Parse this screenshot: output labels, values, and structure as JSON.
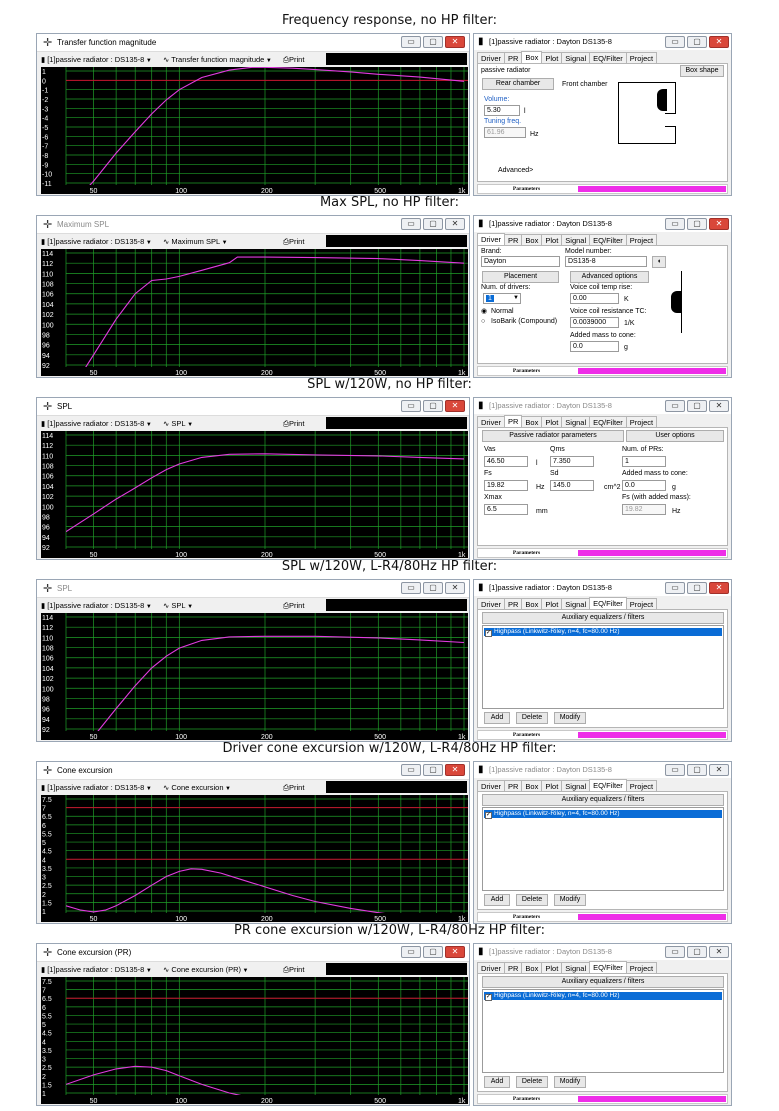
{
  "captions": [
    "Frequency response, no HP filter:",
    "Max SPL, no HP filter:",
    "SPL w/120W, no HP filter:",
    "SPL w/120W, L-R4/80Hz HP filter:",
    "Driver cone excursion w/120W, L-R4/80Hz HP filter:",
    "PR cone excursion w/120W, L-R4/80Hz HP filter:"
  ],
  "common": {
    "driver_select": "[1]passive radiator : DS135-8",
    "print_label": "Print",
    "right_title": "[1]passive radiator : Dayton DS135-8",
    "tabs": [
      "Driver",
      "PR",
      "Box",
      "Plot",
      "Signal",
      "EQ/Filter",
      "Project"
    ],
    "status_label": "Parameters",
    "x_ticks": [
      "50",
      "100",
      "200",
      "500",
      "1k"
    ],
    "colors": {
      "plot_bg": "#000000",
      "grid": "#1f9e28",
      "curve": "#e23be0",
      "ref_line": "#c8102e",
      "status_bar": "#ee2ee8"
    }
  },
  "graphs": [
    {
      "title": "Transfer function magnitude",
      "view": "Transfer function magnitude",
      "y_ticks": [
        "1",
        "0",
        "-1",
        "-2",
        "-3",
        "-4",
        "-5",
        "-6",
        "-7",
        "-8",
        "-9",
        "-10",
        "-11"
      ],
      "curve": [
        [
          40,
          -14
        ],
        [
          50,
          -10.8
        ],
        [
          60,
          -7.8
        ],
        [
          70,
          -5.5
        ],
        [
          80,
          -3.6
        ],
        [
          90,
          -2.1
        ],
        [
          100,
          -1
        ],
        [
          120,
          0.3
        ],
        [
          150,
          1.1
        ],
        [
          180,
          1.4
        ],
        [
          200,
          1.4
        ],
        [
          250,
          1.3
        ],
        [
          300,
          1.15
        ],
        [
          400,
          0.9
        ],
        [
          500,
          0.65
        ],
        [
          700,
          0.35
        ],
        [
          1000,
          -0.1
        ]
      ],
      "ref": [
        0
      ]
    },
    {
      "title": "Maximum SPL",
      "view": "Maximum SPL",
      "y_ticks": [
        "114",
        "112",
        "110",
        "108",
        "106",
        "104",
        "102",
        "100",
        "98",
        "96",
        "94",
        "92"
      ],
      "curve": [
        [
          45,
          90
        ],
        [
          50,
          94
        ],
        [
          60,
          101
        ],
        [
          70,
          106
        ],
        [
          80,
          108.6
        ],
        [
          90,
          108.9
        ],
        [
          100,
          109.4
        ],
        [
          120,
          110.6
        ],
        [
          150,
          112.1
        ],
        [
          160,
          113.2
        ],
        [
          200,
          113.2
        ],
        [
          300,
          113.1
        ],
        [
          500,
          112.9
        ],
        [
          700,
          112.5
        ],
        [
          1000,
          112
        ]
      ],
      "ref": []
    },
    {
      "title": "SPL",
      "view": "SPL",
      "y_ticks": [
        "114",
        "112",
        "110",
        "108",
        "106",
        "104",
        "102",
        "100",
        "98",
        "96",
        "94",
        "92"
      ],
      "curve": [
        [
          40,
          95
        ],
        [
          50,
          98.5
        ],
        [
          60,
          101.4
        ],
        [
          70,
          103.6
        ],
        [
          80,
          105.6
        ],
        [
          90,
          107.2
        ],
        [
          100,
          108.3
        ],
        [
          120,
          109.6
        ],
        [
          150,
          110.2
        ],
        [
          200,
          110.3
        ],
        [
          300,
          110.1
        ],
        [
          500,
          109.9
        ],
        [
          700,
          109.6
        ],
        [
          1000,
          109.3
        ]
      ],
      "ref": []
    },
    {
      "title": "SPL",
      "view": "SPL",
      "y_ticks": [
        "114",
        "112",
        "110",
        "108",
        "106",
        "104",
        "102",
        "100",
        "98",
        "96",
        "94",
        "92"
      ],
      "curve": [
        [
          50,
          90.5
        ],
        [
          60,
          96
        ],
        [
          70,
          100.5
        ],
        [
          80,
          104
        ],
        [
          90,
          106.3
        ],
        [
          100,
          107.9
        ],
        [
          120,
          109.4
        ],
        [
          150,
          110.1
        ],
        [
          200,
          110.2
        ],
        [
          300,
          110.2
        ],
        [
          500,
          109.9
        ],
        [
          700,
          109.5
        ],
        [
          1000,
          109
        ]
      ],
      "ref": []
    },
    {
      "title": "Cone excursion",
      "view": "Cone excursion",
      "y_ticks": [
        "7.5",
        "7",
        "6.5",
        "6",
        "5.5",
        "5",
        "4.5",
        "4",
        "3.5",
        "3",
        "2.5",
        "2",
        "1.5",
        "1"
      ],
      "curve": [
        [
          40,
          1.3
        ],
        [
          45,
          1.05
        ],
        [
          50,
          0.95
        ],
        [
          55,
          1.05
        ],
        [
          60,
          1.3
        ],
        [
          70,
          1.9
        ],
        [
          80,
          2.5
        ],
        [
          90,
          3.0
        ],
        [
          100,
          3.3
        ],
        [
          110,
          3.45
        ],
        [
          120,
          3.42
        ],
        [
          140,
          3.2
        ],
        [
          160,
          2.9
        ],
        [
          200,
          2.4
        ],
        [
          250,
          1.9
        ],
        [
          300,
          1.55
        ],
        [
          400,
          1.15
        ],
        [
          500,
          0.9
        ],
        [
          700,
          0.6
        ],
        [
          1000,
          0.35
        ]
      ],
      "ref": [
        7,
        4
      ]
    },
    {
      "title": "Cone excursion (PR)",
      "view": "Cone excursion (PR)",
      "y_ticks": [
        "7.5",
        "7",
        "6.5",
        "6",
        "5.5",
        "5",
        "4.5",
        "4",
        "3.5",
        "3",
        "2.5",
        "2",
        "1.5",
        "1"
      ],
      "curve": [
        [
          40,
          1.5
        ],
        [
          50,
          2.05
        ],
        [
          60,
          2.4
        ],
        [
          70,
          2.55
        ],
        [
          80,
          2.5
        ],
        [
          90,
          2.3
        ],
        [
          100,
          2.0
        ],
        [
          120,
          1.5
        ],
        [
          150,
          1.0
        ],
        [
          200,
          0.55
        ],
        [
          300,
          0.2
        ],
        [
          500,
          0.05
        ],
        [
          1000,
          0
        ]
      ],
      "ref": [
        6.5
      ]
    }
  ],
  "box_panel": {
    "type_label": "passive radiator",
    "box_shape_button": "Box shape",
    "rear_chamber": "Rear chamber",
    "front_chamber": "Front chamber",
    "volume_label": "Volume:",
    "volume_value": "5.30",
    "volume_unit": "l",
    "tuning_label": "Tuning freq.",
    "tuning_value": "61.96",
    "tuning_unit": "Hz",
    "advanced": "Advanced>"
  },
  "driver_panel": {
    "brand_label": "Brand:",
    "brand_value": "Dayton",
    "model_label": "Model number:",
    "model_value": "DS135-8",
    "placement_button": "Placement",
    "advanced_button": "Advanced options",
    "num_drivers_label": "Num. of drivers:",
    "num_drivers_value": "1",
    "normal_label": "Normal",
    "isobarik_label": "IsoBarik (Compound)",
    "vc_temp_label": "Voice coil temp rise:",
    "vc_temp_value": "0.00",
    "vc_temp_unit": "K",
    "vc_res_label": "Voice coil resistance TC:",
    "vc_res_value": "0.0039000",
    "vc_res_unit": "1/K",
    "added_mass_label": "Added mass to cone:",
    "added_mass_value": "0.0",
    "added_mass_unit": "g"
  },
  "pr_panel": {
    "pr_params_button": "Passive radiator parameters",
    "user_options_button": "User options",
    "vas_label": "Vas",
    "vas_value": "46.50",
    "vas_unit": "l",
    "qms_label": "Qms",
    "qms_value": "7.350",
    "num_prs_label": "Num. of PRs:",
    "num_prs_value": "1",
    "fs_label": "Fs",
    "fs_value": "19.82",
    "fs_unit": "Hz",
    "sd_label": "Sd",
    "sd_value": "145.0",
    "sd_unit": "cm^2",
    "added_mass_label": "Added mass to cone:",
    "added_mass_value": "0.0",
    "added_mass_unit": "g",
    "xmax_label": "Xmax",
    "xmax_value": "6.5",
    "xmax_unit": "mm",
    "fs_added_label": "Fs (with added mass):",
    "fs_added_value": "19.82",
    "fs_added_unit": "Hz"
  },
  "eq_panel": {
    "aux_button": "Auxiliary equalizers / filters",
    "filter_item": "Highpass (Linkwitz-Riley, n=4, fc=80.00 Hz)",
    "add": "Add",
    "delete": "Delete",
    "modify": "Modify"
  },
  "sections": [
    {
      "graph": 0,
      "left_active": true,
      "right_active": true,
      "right_tab": "Box"
    },
    {
      "graph": 1,
      "left_active": false,
      "right_active": true,
      "right_tab": "Driver"
    },
    {
      "graph": 2,
      "left_active": true,
      "right_active": false,
      "right_tab": "PR"
    },
    {
      "graph": 3,
      "left_active": false,
      "right_active": true,
      "right_tab": "EQ/Filter"
    },
    {
      "graph": 4,
      "left_active": true,
      "right_active": false,
      "right_tab": "EQ/Filter"
    },
    {
      "graph": 5,
      "left_active": true,
      "right_active": false,
      "right_tab": "EQ/Filter"
    }
  ]
}
